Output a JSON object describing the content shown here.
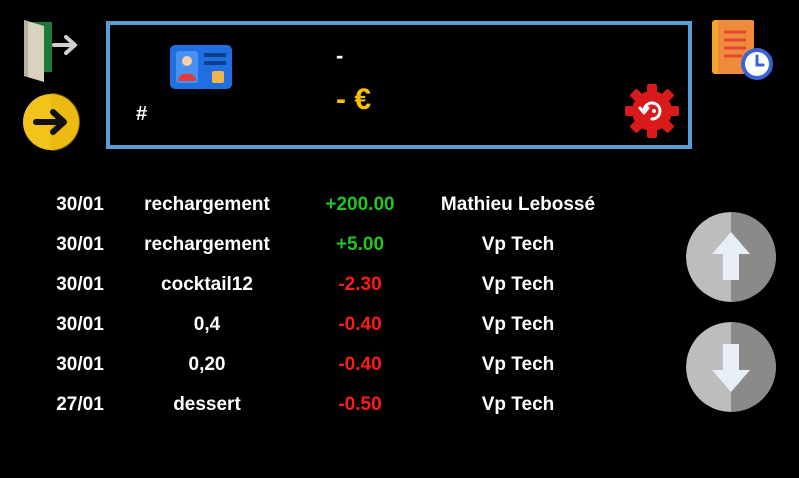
{
  "panel": {
    "hash": "#",
    "holder_name": "-",
    "balance": "- €"
  },
  "icons": {
    "exit": "exit-door-icon",
    "next": "arrow-right-circle-icon",
    "history": "document-clock-icon",
    "card": "id-card-icon",
    "settings": "gear-reset-icon",
    "scroll_up": "arrow-up-icon",
    "scroll_down": "arrow-down-icon"
  },
  "colors": {
    "panel_border": "#5b9bd5",
    "balance": "#ffc000",
    "positive": "#22c422",
    "negative": "#ff1a1a"
  },
  "transactions": [
    {
      "date": "30/01",
      "label": "rechargement",
      "amount": "+200.00",
      "who": "Mathieu Lebossé",
      "sign": "pos"
    },
    {
      "date": "30/01",
      "label": "rechargement",
      "amount": "+5.00",
      "who": "Vp Tech",
      "sign": "pos"
    },
    {
      "date": "30/01",
      "label": "cocktail12",
      "amount": "-2.30",
      "who": "Vp Tech",
      "sign": "neg"
    },
    {
      "date": "30/01",
      "label": "0,4",
      "amount": "-0.40",
      "who": "Vp Tech",
      "sign": "neg"
    },
    {
      "date": "30/01",
      "label": "0,20",
      "amount": "-0.40",
      "who": "Vp Tech",
      "sign": "neg"
    },
    {
      "date": "27/01",
      "label": "dessert",
      "amount": "-0.50",
      "who": "Vp Tech",
      "sign": "neg"
    }
  ]
}
